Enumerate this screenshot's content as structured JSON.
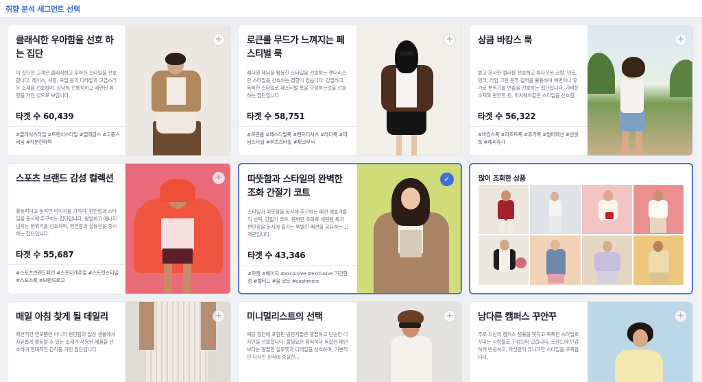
{
  "header": {
    "title": "취향 분석 세그먼트 선택"
  },
  "cards": [
    {
      "title": "클래식한 우아함을 선호 하는 집단",
      "desc": "이 집단의 고객은 클래식하고 우아한 스타일을 선호합니다. 레이스, 셔링, 프릴 등의 디테일과 고급스러운 소재를 선호하며, 상당히 전통적이고 세련된 취향을 가진 것으로 보입니다.",
      "target": "타겟 수 60,439",
      "tags": "#클래식스타일 #트렌치스타일 #엘레강스 #고풍스러움 #차분한매력",
      "action": "+"
    },
    {
      "title": "로큰롤 무드가 느껴지는 페스티벌 룩",
      "desc": "레더와 데님을 활용한 스타일을 선호하는 젠더리스한 스타일을 선호하는 경향이 있습니다. 강렬하고 독특한 스타일로 페스티벌 룩을 구성하는것을 선호하는 집단입니다.",
      "target": "타겟 수 58,751",
      "tags": "#로큰롤 #페스티벌룩 #밴드티셔츠 #레더룩 #데님스타일 #부츠스타일 #체크무늬",
      "action": "+"
    },
    {
      "title": "상큼 바캉스 룩",
      "desc": "밝고 화사한 컬러를 선호하고 톤다운된 코랄, 민트, 핑크, 라임 그린 등의 컬러를 활용하여 해변이나 휴가로 분위기를 연출을 선호하는 집단입니다. 가벼운 소재와 편안한 핏, 비치웨어같은 스타일을 선호함.",
      "target": "타겟 수 56,322",
      "tags": "#바캉스룩 #리조트룩 #휴가룩 #썸머패션 #선셋룩 #해피휴가",
      "action": "+"
    },
    {
      "title": "스포츠 브랜드 감성 컬렉션",
      "desc": "활동적이고 동적인 이미지를 가지며, 편안함과 스타일을 동시에 추구하는 집단입니다. 활발하고 에너지 넘치는 분위기를 선호하며, 편안함과 실용성을 중시하는 집단입니다.",
      "target": "타겟 수 55,687",
      "tags": "#스포츠브랜드패션 #스포티캐주얼 #스트릿스타일 #스포츠룩 #브랜드로고",
      "action": "+"
    },
    {
      "title": "따뜻함과 스타일의 완벽한 조화 간절기 코트",
      "desc": "스타일과 따뜻함을 동시에 추구하는 패션 애호가들의 선택, 간절기 코트. 완벽한 조화로 세련된 룩과 편안함을 동시에 즐기는 특별한 패션을 공유하는 고객군입니다.",
      "target": "타겟 수 43,346",
      "tags": "#자켓 #베이지 #exclusive #exclusive 기간한정 #벨티드 #울 코트 #cashmere",
      "action": "✓"
    },
    {
      "title": "매일 아침 찾게 될 데일리",
      "desc": "패션적인 면모뿐만 아니라 편안함과 일상 생활에서 자유롭게 활동할 수 있는 소재가 사용된 제품을 선호하며 현대적인 감각을 가진 집단입니다.",
      "action": "+"
    },
    {
      "title": "미니멀리스트의 선택",
      "desc": "해당 집단에 포함된 방문자들은 깔끔하고 단순한 디자인을 선호합니다. 불필요한 장식이나 복잡한 패턴보다는 깔끔한 실루엣과 디테일을 선호하며, 기본적인 디자인 원칙에 중실한...",
      "action": "+"
    },
    {
      "title": "남다른 캠퍼스 꾸안꾸",
      "desc": "주로 자신의 캠퍼스 생활을 멋지고 독특한 스타일로 꾸미는 사람들로 구성되어 있습니다. 트렌드에 민감하게 반응하고, 자신만의 유니크한 스타일을 구축합니다.",
      "action": "+"
    }
  ],
  "popular": {
    "title": "많이 조회한 상품"
  }
}
